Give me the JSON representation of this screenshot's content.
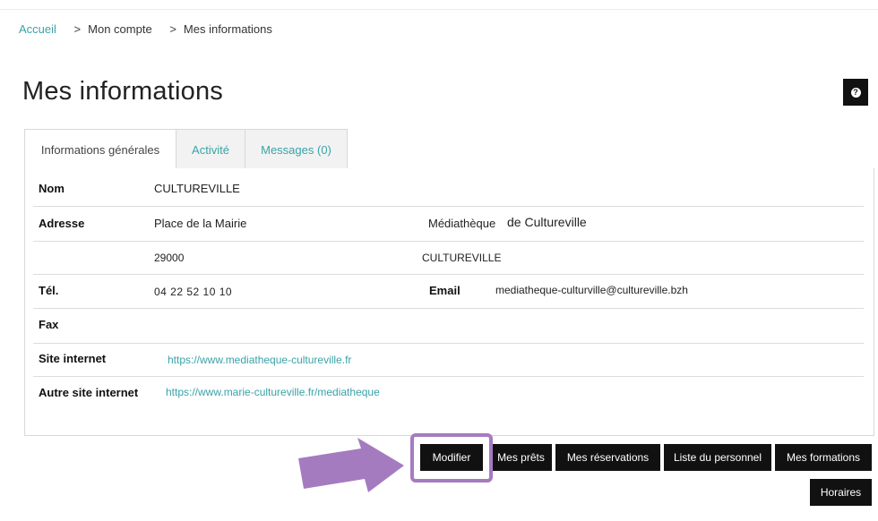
{
  "breadcrumb": {
    "home": "Accueil",
    "sep1": ">",
    "item1": "Mon compte",
    "sep2": ">",
    "item2": "Mes informations"
  },
  "page": {
    "title": "Mes informations",
    "help_glyph": "?"
  },
  "tabs": [
    {
      "label": "Informations générales",
      "active": true
    },
    {
      "label": "Activité",
      "active": false
    },
    {
      "label": "Messages (0)",
      "active": false
    }
  ],
  "info": {
    "nom_label": "Nom",
    "nom_value": "CULTUREVILLE",
    "adresse_label": "Adresse",
    "adresse_value": "Place de la Mairie",
    "adresse_right_prefix": "Médiathèque",
    "adresse_right_value": "de Cultureville",
    "cp_value": "29000",
    "ville_value": "CULTUREVILLE",
    "tel_label": "Tél.",
    "tel_value": "04 22 52 10 10",
    "email_label": "Email",
    "email_value": "mediatheque-culturville@cultureville.bzh",
    "fax_label": "Fax",
    "site_label": "Site internet",
    "site_value": "https://www.mediatheque-cultureville.fr",
    "autre_label": "Autre site internet",
    "autre_value": "https://www.marie-cultureville.fr/mediatheque"
  },
  "actions": {
    "modifier": "Modifier",
    "prets": "Mes prêts",
    "reservations": "Mes réservations",
    "personnel": "Liste du personnel",
    "formations": "Mes formations",
    "horaires": "Horaires"
  },
  "annotation": {
    "arrow_color": "#a57bc0",
    "highlight_color": "#a57bc0"
  }
}
